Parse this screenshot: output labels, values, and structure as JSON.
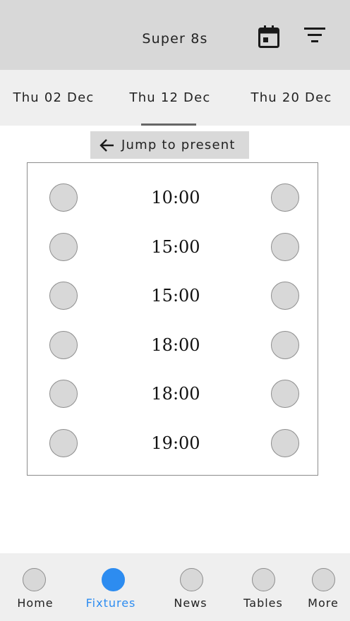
{
  "header": {
    "title": "Super 8s",
    "calendar_icon": "calendar-icon",
    "filter_icon": "filter-icon"
  },
  "date_tabs": [
    {
      "label": "Thu 02 Dec",
      "selected": false
    },
    {
      "label": "Thu 12 Dec",
      "selected": true
    },
    {
      "label": "Thu 20 Dec",
      "selected": false
    }
  ],
  "jump": {
    "label": "Jump to present",
    "icon": "arrow-left-icon"
  },
  "fixtures": [
    {
      "time": "10:00"
    },
    {
      "time": "15:00"
    },
    {
      "time": "15:00"
    },
    {
      "time": "18:00"
    },
    {
      "time": "18:00"
    },
    {
      "time": "19:00"
    }
  ],
  "bottom_nav": [
    {
      "label": "Home",
      "active": false
    },
    {
      "label": "Fixtures",
      "active": true
    },
    {
      "label": "News",
      "active": false
    },
    {
      "label": "Tables",
      "active": false
    },
    {
      "label": "More",
      "active": false
    }
  ],
  "colors": {
    "accent": "#2d8cf0",
    "header_bg": "#d8d8d8",
    "tabs_bg": "#efefef",
    "placeholder": "#d8d8d8"
  }
}
